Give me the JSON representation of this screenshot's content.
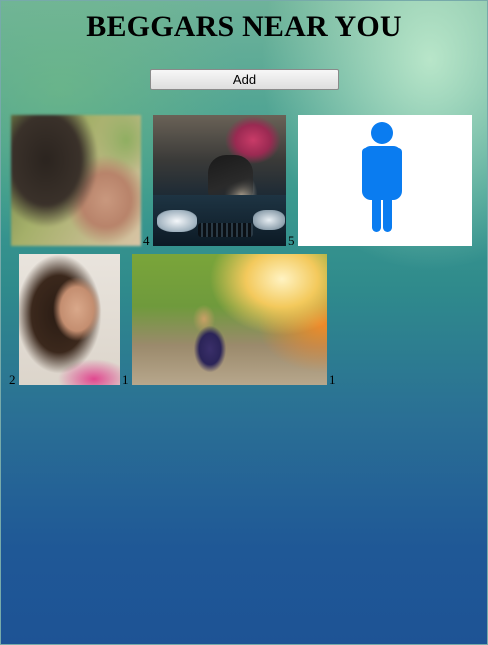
{
  "page": {
    "title": "BEGGARS NEAR YOU",
    "add_button_label": "Add"
  },
  "beggars": [
    {
      "photo": "blurred-face-photo",
      "count": "4"
    },
    {
      "photo": "girl-on-car-photo",
      "count": "5"
    },
    {
      "photo": "person-placeholder-icon",
      "count": ""
    },
    {
      "photo": "woman-portrait-photo",
      "count_left": "2",
      "count": "1"
    },
    {
      "photo": "girl-sunlight-photo",
      "count": "1"
    }
  ],
  "colors": {
    "placeholder_person": "#0a7cf0",
    "background_top": "#6fb39a",
    "background_bottom": "#1e5395"
  }
}
